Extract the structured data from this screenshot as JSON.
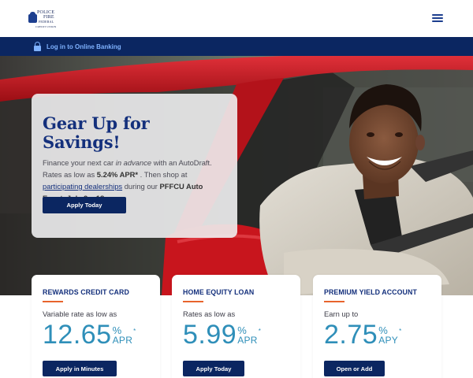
{
  "header": {
    "logo": {
      "line1": "POLICE",
      "line2": "FIRE",
      "line3": "FEDERAL",
      "line4": "CREDIT UNION"
    },
    "menu_icon": "hamburger-menu-icon"
  },
  "loginbar": {
    "icon": "lock-icon",
    "label": "Log in to Online Banking"
  },
  "hero": {
    "title": "Gear Up for Savings!",
    "body_1": "Finance your next car ",
    "body_2": "in advance",
    "body_3": " with an AutoDraft. Rates as low as ",
    "body_rate": "5.24% APR*",
    "body_4": " . Then shop at ",
    "body_link": "participating dealerships",
    "body_5": " during our ",
    "body_event": "PFFCU Auto Event, July 9 – 18",
    "body_6": " .",
    "button": "Apply Today"
  },
  "products": [
    {
      "title": "REWARDS CREDIT CARD",
      "subtitle": "Variable rate as low as",
      "rate": "12.65",
      "pct": "%",
      "unit": "APR",
      "star": "*",
      "button": "Apply in Minutes"
    },
    {
      "title": "HOME EQUITY LOAN",
      "subtitle": "Rates as low as",
      "rate": "5.99",
      "pct": "%",
      "unit": "APR",
      "star": "*",
      "button": "Apply Today"
    },
    {
      "title": "PREMIUM YIELD ACCOUNT",
      "subtitle": "Earn up to",
      "rate": "2.75",
      "pct": "%",
      "unit": "APY",
      "star": "*",
      "button": "Open or Add"
    }
  ],
  "colors": {
    "navy": "#0b2661",
    "title_blue": "#14307c",
    "rate_teal": "#2f8fb9",
    "accent_orange": "#e8642c",
    "car_red": "#c8151d"
  }
}
